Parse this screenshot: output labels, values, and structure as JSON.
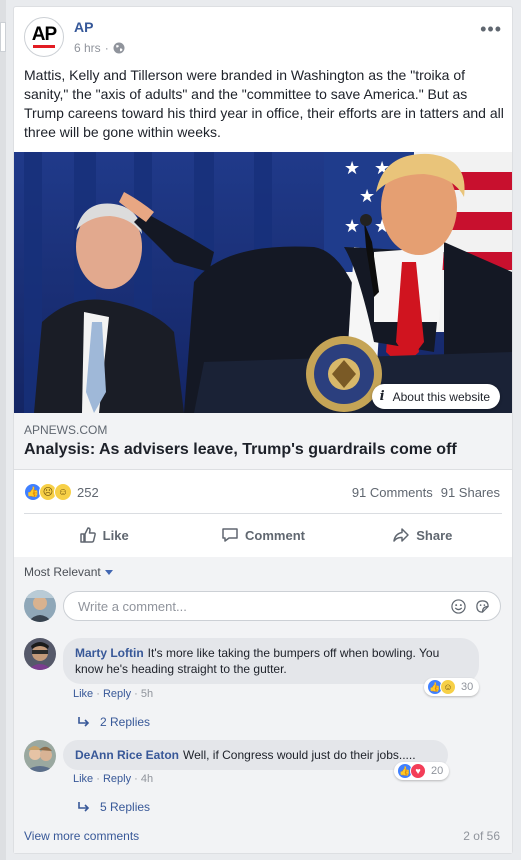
{
  "post": {
    "page_name": "AP",
    "avatar_text": "AP",
    "time": "6 hrs",
    "separator": "·",
    "text": "Mattis, Kelly and Tillerson were branded in Washington as the \"troika of sanity,\" the \"axis of adults\" and the \"committee to save America.\" But as Trump careens toward his third year in office, their efforts are in tatters and all three will be gone within weeks.",
    "more_label": "•••"
  },
  "link": {
    "about_label": "About this website",
    "domain": "APNEWS.COM",
    "headline": "Analysis: As advisers leave, Trump's guardrails come off"
  },
  "stats": {
    "reactions": "252",
    "comments": "91 Comments",
    "shares": "91 Shares"
  },
  "actions": {
    "like": "Like",
    "comment": "Comment",
    "share": "Share"
  },
  "comments": {
    "sort_label": "Most Relevant",
    "compose_placeholder": "Write a comment...",
    "items": [
      {
        "name": "Marty Loftin",
        "text": "It's more like taking the bumpers off when bowling. You know he's heading straight to the gutter.",
        "like": "Like",
        "reply": "Reply",
        "time": "5h",
        "reaction_count": "30",
        "replies_label": "2 Replies"
      },
      {
        "name": "DeAnn Rice Eaton",
        "text": "Well, if Congress would just do their jobs.....",
        "like": "Like",
        "reply": "Reply",
        "time": "4h",
        "reaction_count": "20",
        "replies_label": "5 Replies"
      }
    ],
    "view_more": "View more comments",
    "pager": "2 of 56"
  },
  "colors": {
    "link_blue": "#385898",
    "like_blue": "#4080ff",
    "ap_red": "#e21c23",
    "tie_red": "#d0141f"
  }
}
